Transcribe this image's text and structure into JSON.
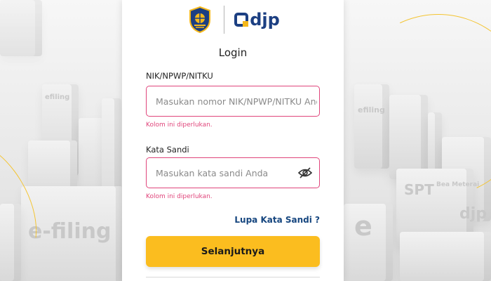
{
  "branding": {
    "emblem_icon": "kemenkeu-emblem-icon",
    "logo_text": "djp",
    "logo_icon": "djp-logo-icon",
    "brand_blue": "#1c3f82",
    "brand_yellow": "#f5b81b"
  },
  "login": {
    "title": "Login",
    "id_field": {
      "label": "NIK/NPWP/NITKU",
      "placeholder": "Masukan nomor NIK/NPWP/NITKU Anda",
      "value": "",
      "error": "Kolom ini diperlukan."
    },
    "password_field": {
      "label": "Kata Sandi",
      "placeholder": "Masukan kata sandi Anda",
      "value": "",
      "error": "Kolom ini diperlukan.",
      "toggle_icon": "eye-slash-icon"
    },
    "forgot_link": "Lupa Kata Sandi ?",
    "submit_label": "Selanjutnya",
    "error_color": "#e0457b",
    "button_color": "#fbbd1f"
  },
  "background": {
    "labels": [
      "efiling",
      "e-filing",
      "SPT",
      "Bea Meterai",
      "djp",
      "e"
    ]
  }
}
